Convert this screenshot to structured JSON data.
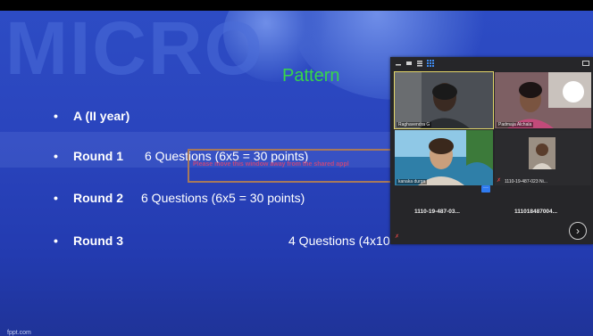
{
  "slide": {
    "heading_text": "MICRO",
    "title": "Pattern",
    "intro_bullet": "A (II year)",
    "rounds": [
      {
        "label": "Round 1",
        "questions": "6 Questions (6x5 = 30 points)"
      },
      {
        "label": "Round 2",
        "questions": "6 Questions (6x5 = 30 points)"
      },
      {
        "label": "Round 3",
        "questions": "4 Questions (4x10"
      }
    ],
    "bullet_symbol": "•",
    "brand": "fppt.com"
  },
  "overlay": {
    "warning": "Please move this window away from the shared appl"
  },
  "meeting": {
    "participants": [
      {
        "name": "Raghavendra G"
      },
      {
        "name": "Padmaja Alchala"
      },
      {
        "name": "kanaka durga"
      },
      {
        "name": "1110-19-487-023 Ni..."
      }
    ],
    "bottom_tiles": [
      {
        "label": "1110-19-487-03..."
      },
      {
        "label": "111018487004..."
      }
    ],
    "more_button": "···",
    "next_button": "›"
  },
  "colors": {
    "slide_bg": "#2a44bd",
    "title_green": "#37d64a",
    "active_speaker_border": "#e3d76a",
    "warning_text": "#c2477e",
    "warning_border": "#a7795b"
  },
  "icons": [
    "minimize-icon",
    "grid-view-icon",
    "speaker-view-icon",
    "apps-icon",
    "expand-icon",
    "mic-off-icon",
    "chevron-right-icon"
  ]
}
